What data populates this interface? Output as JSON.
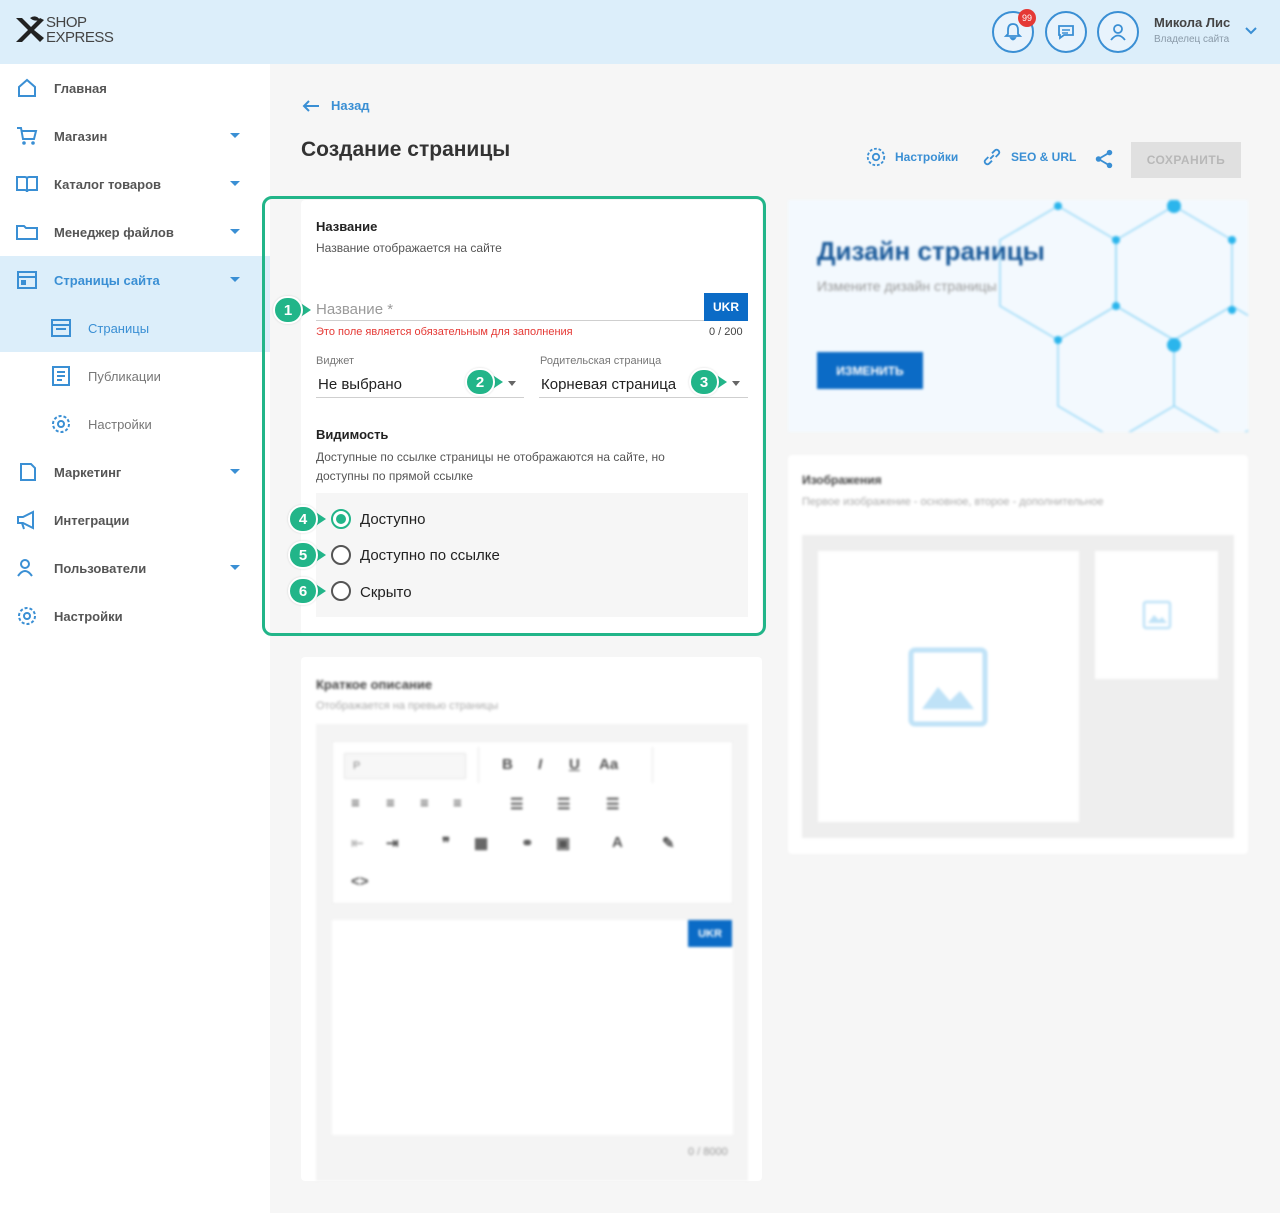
{
  "brand": {
    "line1": "SHOP",
    "line2": "EXPRESS"
  },
  "header": {
    "notifications_count": "99",
    "user_name": "Микола Лис",
    "user_role": "Владелец сайта"
  },
  "sidebar": {
    "items": [
      {
        "label": "Главная",
        "icon": "home-icon"
      },
      {
        "label": "Магазин",
        "icon": "cart-icon"
      },
      {
        "label": "Каталог товаров",
        "icon": "book-icon"
      },
      {
        "label": "Менеджер файлов",
        "icon": "folder-icon"
      },
      {
        "label": "Страницы сайта",
        "icon": "pages-icon"
      },
      {
        "label": "Маркетинг",
        "icon": "marketing-icon"
      },
      {
        "label": "Интеграции",
        "icon": "megaphone-icon"
      },
      {
        "label": "Пользователи",
        "icon": "users-icon"
      },
      {
        "label": "Настройки",
        "icon": "gear-icon"
      }
    ],
    "sub_items": [
      {
        "label": "Страницы",
        "icon": "page-icon"
      },
      {
        "label": "Публикации",
        "icon": "publications-icon"
      },
      {
        "label": "Настройки",
        "icon": "gear-icon"
      }
    ]
  },
  "page": {
    "back_label": "Назад",
    "title": "Создание страницы",
    "toolbar": {
      "settings_label": "Настройки",
      "seo_label": "SEO & URL",
      "save_label": "СОХРАНИТЬ"
    }
  },
  "form": {
    "name_section_title": "Название",
    "name_section_subtitle": "Название отображается на сайте",
    "name_placeholder": "Название *",
    "lang_button": "UKR",
    "error_text": "Это поле является обязательным для заполнения",
    "counter": "0 / 200",
    "widget_label": "Виджет",
    "widget_value": "Не выбрано",
    "parent_label": "Родительская страница",
    "parent_value": "Корневая страница",
    "visibility_title": "Видимость",
    "visibility_subtitle_1": "Доступные по ссылке страницы не отображаются на сайте, но",
    "visibility_subtitle_2": "доступны по прямой ссылке",
    "visibility_options": [
      "Доступно",
      "Доступно по ссылке",
      "Скрыто"
    ],
    "visibility_selected": "Доступно"
  },
  "markers": [
    "1",
    "2",
    "3",
    "4",
    "5",
    "6"
  ],
  "description": {
    "title": "Краткое описание",
    "subtitle": "Отображается на превью страницы",
    "format_value": "P",
    "lang_button": "UKR",
    "counter": "0 / 8000"
  },
  "design": {
    "title": "Дизайн страницы",
    "subtitle": "Измените дизайн страницы",
    "button": "ИЗМЕНИТЬ"
  },
  "images": {
    "title": "Изображения",
    "subtitle": "Первое изображение - основное, второе - дополнительное"
  },
  "colors": {
    "accent": "#3a8fd4",
    "primary_button": "#0b6bc6",
    "highlight": "#22b589",
    "error": "#e53935"
  }
}
